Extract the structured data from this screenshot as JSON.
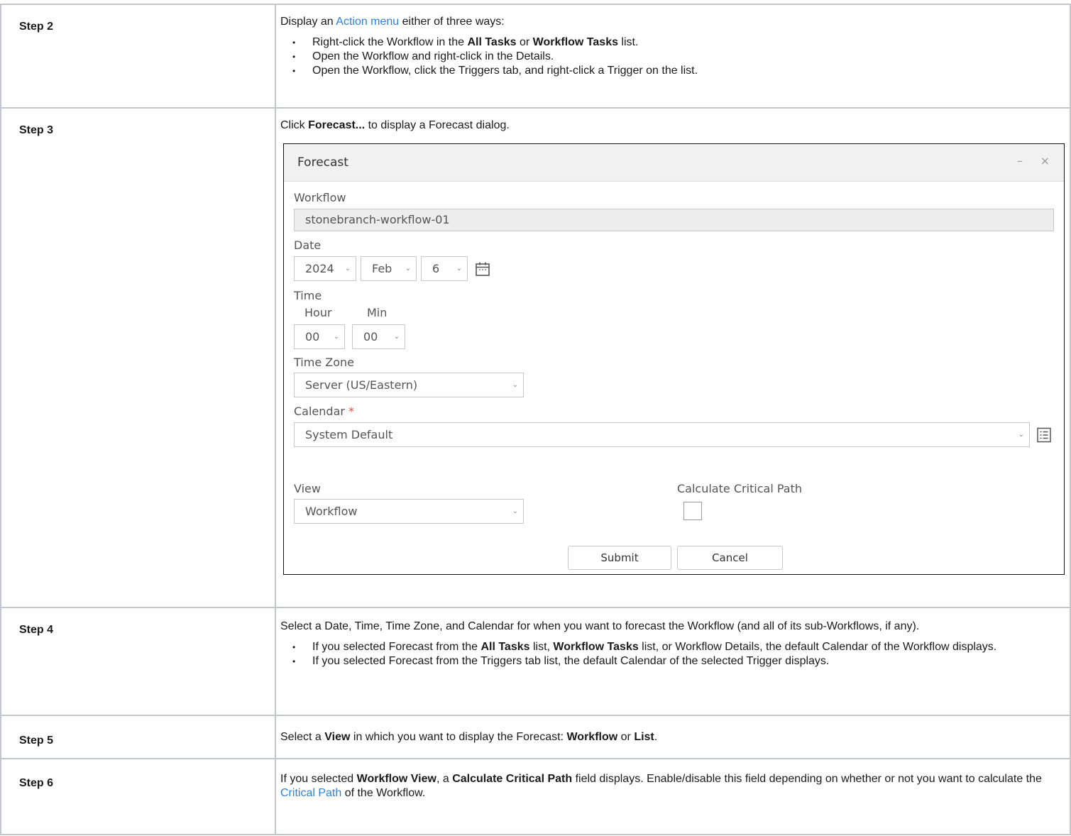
{
  "steps": [
    {
      "label": "Step 2",
      "intro_pre": "Display an ",
      "intro_link": "Action menu",
      "intro_post": " either of three ways:",
      "bullets": [
        {
          "t1": "Right-click the Workflow in the ",
          "b1": "All Tasks",
          "t2": " or ",
          "b2": "Workflow Tasks",
          "t3": " list."
        },
        {
          "t1": "Open the Workflow and right-click in the Details."
        },
        {
          "t1": "Open the Workflow, click the Triggers tab, and right-click a Trigger on the list."
        }
      ]
    },
    {
      "label": "Step 3",
      "pre": "Click ",
      "bold": "Forecast...",
      "post": " to display a Forecast dialog."
    },
    {
      "label": "Step 4",
      "intro": "Select a Date, Time, Time Zone, and Calendar for when you want to forecast the Workflow (and all of its sub-Workflows, if any).",
      "bullets": [
        {
          "t1": "If you selected Forecast from the ",
          "b1": "All Tasks",
          "t2": " list, ",
          "b2": "Workflow Tasks",
          "t3": " list, or Workflow Details, the default Calendar of the Workflow displays."
        },
        {
          "t1": "If you selected Forecast from the Triggers tab list, the default Calendar of the selected Trigger displays."
        }
      ]
    },
    {
      "label": "Step 5",
      "t1": "Select a ",
      "b1": "View",
      "t2": " in which you want to display the Forecast: ",
      "b2": "Workflow",
      "t3": " or ",
      "b3": "List",
      "t4": "."
    },
    {
      "label": "Step 6",
      "t1": "If you selected ",
      "b1": "Workflow View",
      "t2": ", a ",
      "b2": "Calculate Critical Path",
      "t3": " field displays. Enable/disable this field depending on whether or not you want to calculate the ",
      "link": "Critical Path",
      "t4": " of the Workflow."
    }
  ],
  "dialog": {
    "title": "Forecast",
    "minimize": "–",
    "close": "×",
    "workflow_label": "Workflow",
    "workflow_value": "stonebranch-workflow-01",
    "date_label": "Date",
    "year": "2024",
    "month": "Feb",
    "day": "6",
    "time_label": "Time",
    "hour_label": "Hour",
    "min_label": "Min",
    "hour": "00",
    "min": "00",
    "tz_label": "Time Zone",
    "tz_value": "Server (US/Eastern)",
    "calendar_label": "Calendar",
    "required_mark": "*",
    "calendar_value": "System Default",
    "view_label": "View",
    "view_value": "Workflow",
    "critical_label": "Calculate Critical Path",
    "critical_checked": false,
    "submit": "Submit",
    "cancel": "Cancel",
    "chevron": "⌄"
  },
  "icons": {
    "calendar": "calendar-icon",
    "list": "list-icon"
  }
}
